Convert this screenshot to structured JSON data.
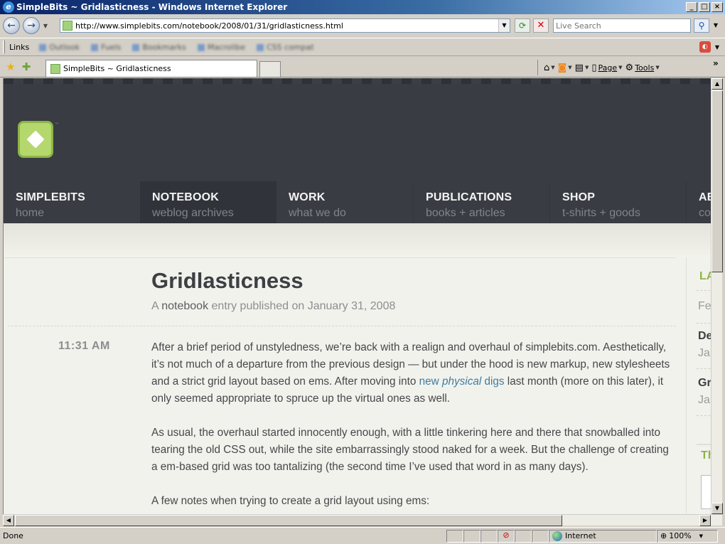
{
  "window": {
    "title": "SimpleBits ~ Gridlasticness - Windows Internet Explorer",
    "app_icon": "ie-icon",
    "controls": [
      "minimize",
      "maximize",
      "close"
    ]
  },
  "address_bar": {
    "url": "http://www.simplebits.com/notebook/2008/01/31/gridlasticness.html",
    "search_placeholder": "Live Search"
  },
  "links_bar": {
    "label": "Links",
    "items": [
      "Outlook",
      "Fuels",
      "Bookmarks",
      "Macrolibe",
      "CSS compat"
    ]
  },
  "tab_bar": {
    "active_tab": "SimpleBits ~ Gridlasticness",
    "commands": [
      {
        "name": "home",
        "label": ""
      },
      {
        "name": "feeds",
        "label": ""
      },
      {
        "name": "print",
        "label": ""
      },
      {
        "name": "page",
        "label": "Page"
      },
      {
        "name": "tools",
        "label": "Tools"
      }
    ]
  },
  "site": {
    "nav": [
      {
        "title": "SIMPLEBITS",
        "subtitle": "home",
        "active": false
      },
      {
        "title": "NOTEBOOK",
        "subtitle": "weblog archives",
        "active": true
      },
      {
        "title": "WORK",
        "subtitle": "what we do",
        "active": false
      },
      {
        "title": "PUBLICATIONS",
        "subtitle": "books + articles",
        "active": false
      },
      {
        "title": "SHOP",
        "subtitle": "t-shirts + goods",
        "active": false
      },
      {
        "title": "AB",
        "subtitle": "co",
        "active": false
      }
    ],
    "colors": {
      "header_bg": "#393c42",
      "accent_green": "#8cb547",
      "link": "#3e7ca3"
    }
  },
  "article": {
    "title": "Gridlasticness",
    "meta_prefix": "A ",
    "meta_link": "notebook",
    "meta_suffix": " entry published on January 31, 2008",
    "time": "11:31 AM",
    "p1_before": "After a brief period of unstyledness, we’re back with a realign and overhaul of simplebits.com. Aesthetically, it’s not much of a departure from the previous design — but under the hood is new markup, new stylesheets and a strict grid layout based on ems. After moving into ",
    "p1_link_a": "new ",
    "p1_link_em": "physical",
    "p1_link_b": " digs",
    "p1_after": " last month (more on this later), it only seemed appropriate to spruce up the virtual ones as well.",
    "p2": "As usual, the overhaul started innocently enough, with a little tinkering here and there that snowballed into tearing the old CSS out, while the site embarrassingly stood naked for a week. But the challenge of creating a em-based grid was too tantalizing (the second time I’ve used that word in as many days).",
    "p3": "A few notes when trying to create a grid layout using ems:"
  },
  "sidebar": {
    "heading1": "LA",
    "item1": "Fe",
    "item2_title": "De",
    "item2_sub": "Jar",
    "item3_title": "Gr",
    "item3_sub": "Jar",
    "heading2": "Th"
  },
  "status_bar": {
    "status": "Done",
    "zone": "Internet",
    "zoom": "100%"
  }
}
